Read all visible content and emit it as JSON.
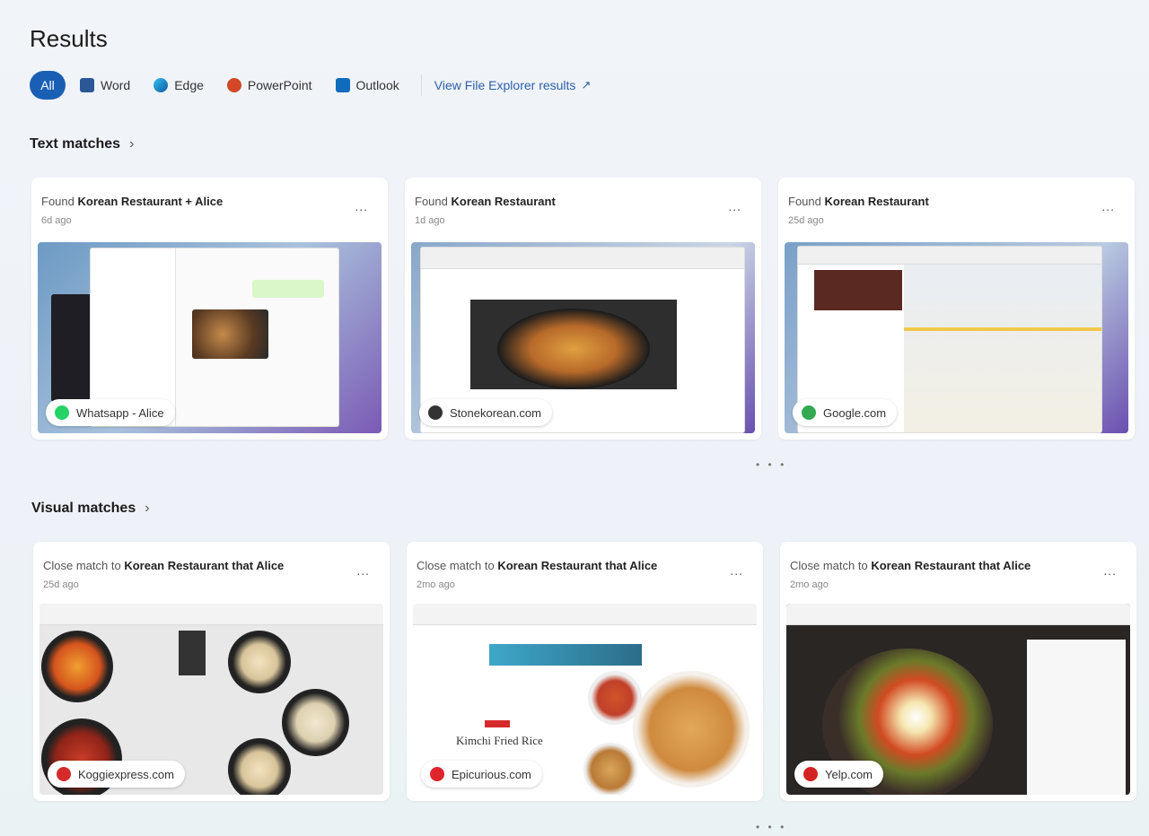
{
  "title": "Results",
  "filters": [
    {
      "label": "All",
      "active": true
    },
    {
      "label": "Word",
      "icon": "word-icon",
      "color": "#2b5797"
    },
    {
      "label": "Edge",
      "icon": "edge-icon",
      "color": "#1f9ad6"
    },
    {
      "label": "PowerPoint",
      "icon": "powerpoint-icon",
      "color": "#d24726"
    },
    {
      "label": "Outlook",
      "icon": "outlook-icon",
      "color": "#0f6cbd"
    }
  ],
  "file_explorer_link": "View File Explorer results",
  "text_matches": {
    "title": "Text matches",
    "cards": [
      {
        "prefix": "Found",
        "query": "Korean Restaurant + Alice",
        "time": "6d ago",
        "source": "Whatsapp - Alice",
        "source_color": "#25d366"
      },
      {
        "prefix": "Found",
        "query": "Korean Restaurant",
        "time": "1d ago",
        "source": "Stonekorean.com",
        "source_color": "#333333"
      },
      {
        "prefix": "Found",
        "query": "Korean Restaurant",
        "time": "25d ago",
        "source": "Google.com",
        "source_color": "#34a853"
      }
    ]
  },
  "visual_matches": {
    "title": "Visual matches",
    "cards": [
      {
        "prefix": "Close match to",
        "query": "Korean Restaurant that Alice",
        "time": "25d ago",
        "source": "Koggiexpress.com",
        "source_color": "#d42a2a"
      },
      {
        "prefix": "Close match to",
        "query": "Korean Restaurant that Alice",
        "time": "2mo ago",
        "source": "Epicurious.com",
        "source_color": "#e0242b"
      },
      {
        "prefix": "Close match to",
        "query": "Korean Restaurant that Alice",
        "time": "2mo ago",
        "source": "Yelp.com",
        "source_color": "#d32323"
      }
    ]
  },
  "thumb_text": {
    "kimchi": "Kimchi Fried Rice"
  },
  "more_label": "...",
  "pagination": "• • •"
}
